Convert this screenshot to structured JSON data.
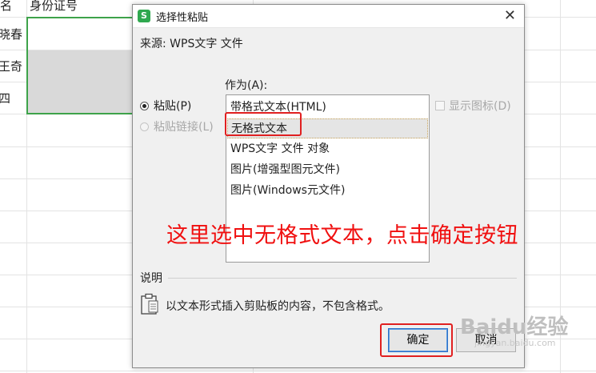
{
  "sheet": {
    "header_left": "名",
    "header_main": "身份证号",
    "rows": [
      "晓春",
      "王奇",
      "四"
    ]
  },
  "dialog": {
    "title": "选择性粘贴",
    "icon_letter": "S",
    "close_glyph": "✕",
    "source": "来源: WPS文字 文件",
    "as_label": "作为(A):",
    "radios": [
      {
        "label": "粘贴(P)",
        "checked": true,
        "enabled": true
      },
      {
        "label": "粘贴链接(L)",
        "checked": false,
        "enabled": false
      }
    ],
    "list_items": [
      "带格式文本(HTML)",
      "无格式文本",
      "WPS文字 文件 对象",
      "图片(增强型图元文件)",
      "图片(Windows元文件)"
    ],
    "selected_index": 1,
    "show_icon_label": "显示图标(D)",
    "description_label": "说明",
    "description_icon": "clipboard-icon",
    "description_text": "以文本形式插入剪贴板的内容，不包含格式。",
    "ok_label": "确定",
    "cancel_label": "取消"
  },
  "annotation": "这里选中无格式文本，点击确定按钮",
  "watermark": {
    "main": "Baidu经验",
    "sub": "jingyan.baidu.com"
  },
  "colors": {
    "accent_red": "#e02020",
    "selection_green": "#3ea34a",
    "ok_border": "#2d70c8"
  }
}
